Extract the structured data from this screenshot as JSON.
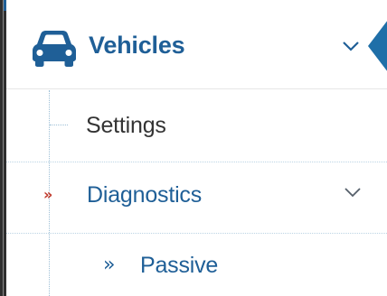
{
  "nav": {
    "vehicles": {
      "label": "Vehicles",
      "icon": "car-icon",
      "expanded": true,
      "active": true
    },
    "settings": {
      "label": "Settings"
    },
    "diagnostics": {
      "label": "Diagnostics",
      "marker_icon": "double-angle-right-icon",
      "expanded": true
    },
    "passive": {
      "label": "Passive",
      "marker_icon": "double-angle-right-icon"
    }
  },
  "colors": {
    "primary": "#1f5f97",
    "text_default": "#333333",
    "marker_red": "#c0392b",
    "chevron": "#1f5f97"
  }
}
